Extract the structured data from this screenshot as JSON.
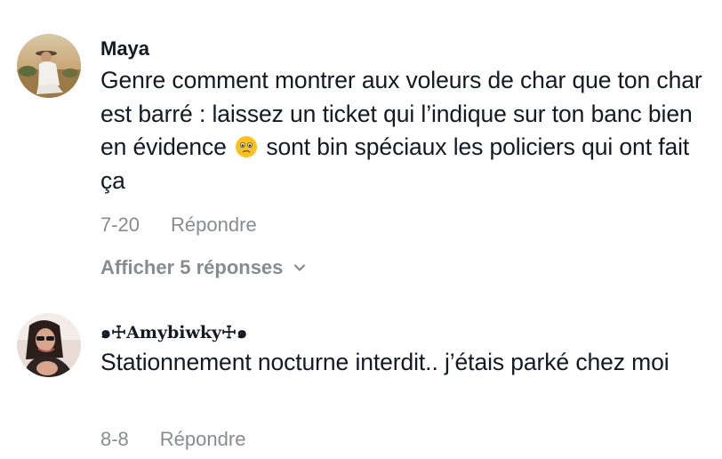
{
  "comments": [
    {
      "username": "Maya",
      "text_before_emoji": "Genre comment montrer aux voleurs de char que ton char est barré : laissez un ticket qui l’indique sur ton banc bien en évidence",
      "emoji_icon": "face-holding-back-tears-emoji",
      "text_after_emoji": "sont bin spéciaux les policiers qui ont fait ça",
      "date": "7-20",
      "reply_label": "Répondre",
      "view_replies_label": "Afficher 5 réponses",
      "view_replies_icon": "chevron-down-icon"
    },
    {
      "username": "๑☩Amybiwky☩๑",
      "text": "Stationnement nocturne interdit.. j’étais parké chez moi",
      "date": "8-8",
      "reply_label": "Répondre"
    }
  ],
  "colors": {
    "primary_text": "#161823",
    "secondary_text": "#8a8b91",
    "background": "#ffffff"
  }
}
